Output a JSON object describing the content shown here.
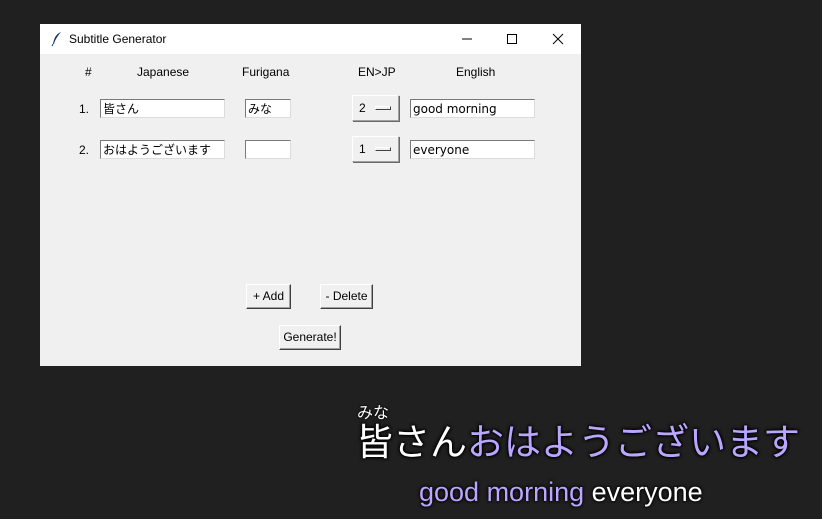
{
  "window": {
    "title": "Subtitle Generator"
  },
  "headers": {
    "number": "#",
    "japanese": "Japanese",
    "furigana": "Furigana",
    "enjp": "EN>JP",
    "english": "English"
  },
  "rows": [
    {
      "number": "1.",
      "japanese": "皆さん",
      "furigana": "みな",
      "enjp": "2",
      "english": "good morning"
    },
    {
      "number": "2.",
      "japanese": "おはようございます",
      "furigana": "",
      "enjp": "1",
      "english": "everyone"
    }
  ],
  "buttons": {
    "add": "+ Add",
    "delete": "- Delete",
    "generate": "Generate!"
  },
  "subtitle": {
    "furigana": "みな",
    "japanese_part1": "皆さん",
    "japanese_part2": "おはようございます",
    "english_part1": "good morning",
    "english_part2": " everyone",
    "colors": {
      "primary": "#ffffff",
      "secondary": "#b8a6ff",
      "background": "#202020"
    }
  }
}
